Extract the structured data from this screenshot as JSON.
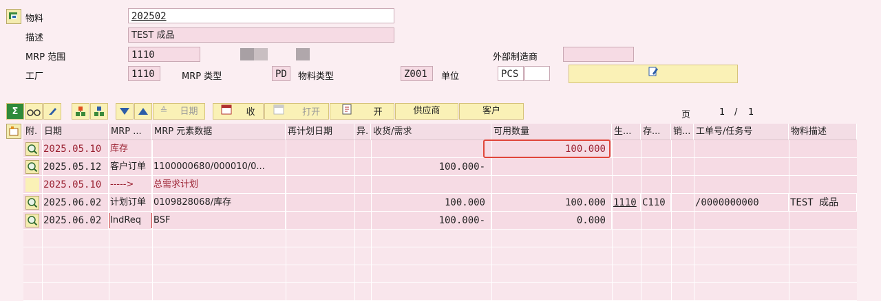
{
  "header": {
    "material_label": "物料",
    "material_value": "202502",
    "description_label": "描述",
    "description_value": "TEST 成品",
    "mrp_area_label": "MRP 范围",
    "mrp_area_value": "1110",
    "external_mfr_label": "外部制造商",
    "external_mfr_value": "",
    "plant_label": "工厂",
    "plant_value": "1110",
    "mrp_type_label": "MRP 类型",
    "mrp_type_value": "PD",
    "material_type_label": "物料类型",
    "material_type_value": "Z001",
    "unit_label": "单位",
    "unit_value": "PCS"
  },
  "toolbar": {
    "date_label": "日期",
    "receipt_label": "收",
    "open_label": "打开",
    "open2_label": "开",
    "supplier_label": "供应商",
    "customer_label": "客户",
    "page_label": "页",
    "page_current": "1",
    "page_sep": "/",
    "page_total": "1"
  },
  "table": {
    "columns": [
      "附.",
      "日期",
      "MRP ...",
      "MRP 元素数据",
      "再计划日期",
      "异.",
      "收货/需求",
      "可用数量",
      "生...",
      "存...",
      "销...",
      "工单号/任务号",
      "物料描述"
    ],
    "rows": [
      {
        "date": "2025.05.10",
        "mrp": "库存",
        "data": "",
        "qty": "",
        "avail": "100.000",
        "plant": "",
        "stor": "",
        "order": "",
        "desc": "",
        "color": "#9a2030"
      },
      {
        "date": "2025.05.12",
        "mrp": "客户订单",
        "data": "1100000680/000010/0...",
        "qty": "100.000-",
        "avail": "",
        "plant": "",
        "stor": "",
        "order": "",
        "desc": "",
        "color": "#222222"
      },
      {
        "date": "2025.05.10",
        "mrp": "----->",
        "data": "总需求计划",
        "qty": "",
        "avail": "",
        "plant": "",
        "stor": "",
        "order": "",
        "desc": "",
        "color": "#9a2030"
      },
      {
        "date": "2025.06.02",
        "mrp": "计划订单",
        "data": "0109828068/库存",
        "qty": "100.000",
        "avail": "100.000",
        "plant": "1110",
        "stor": "C110",
        "order": "/0000000000",
        "desc": "TEST 成品",
        "color": "#222222"
      },
      {
        "date": "2025.06.02",
        "mrp": "IndReq",
        "data": "BSF",
        "qty": "100.000-",
        "avail": "0.000",
        "plant": "",
        "stor": "",
        "order": "",
        "desc": "",
        "color": "#222222"
      }
    ]
  },
  "colors": {
    "background": "#fbeef2",
    "field_bg": "#f6dbe4",
    "button_bg": "#faf1b6",
    "highlight_border": "#e0463a",
    "stock_text": "#9a2030"
  },
  "icons": [
    "material-icon",
    "sum-icon",
    "glasses-icon",
    "pencil-icon",
    "tree-icon",
    "sort-down-icon",
    "sort-up-icon",
    "calendar-icon",
    "edit-icon",
    "detail-icon"
  ]
}
